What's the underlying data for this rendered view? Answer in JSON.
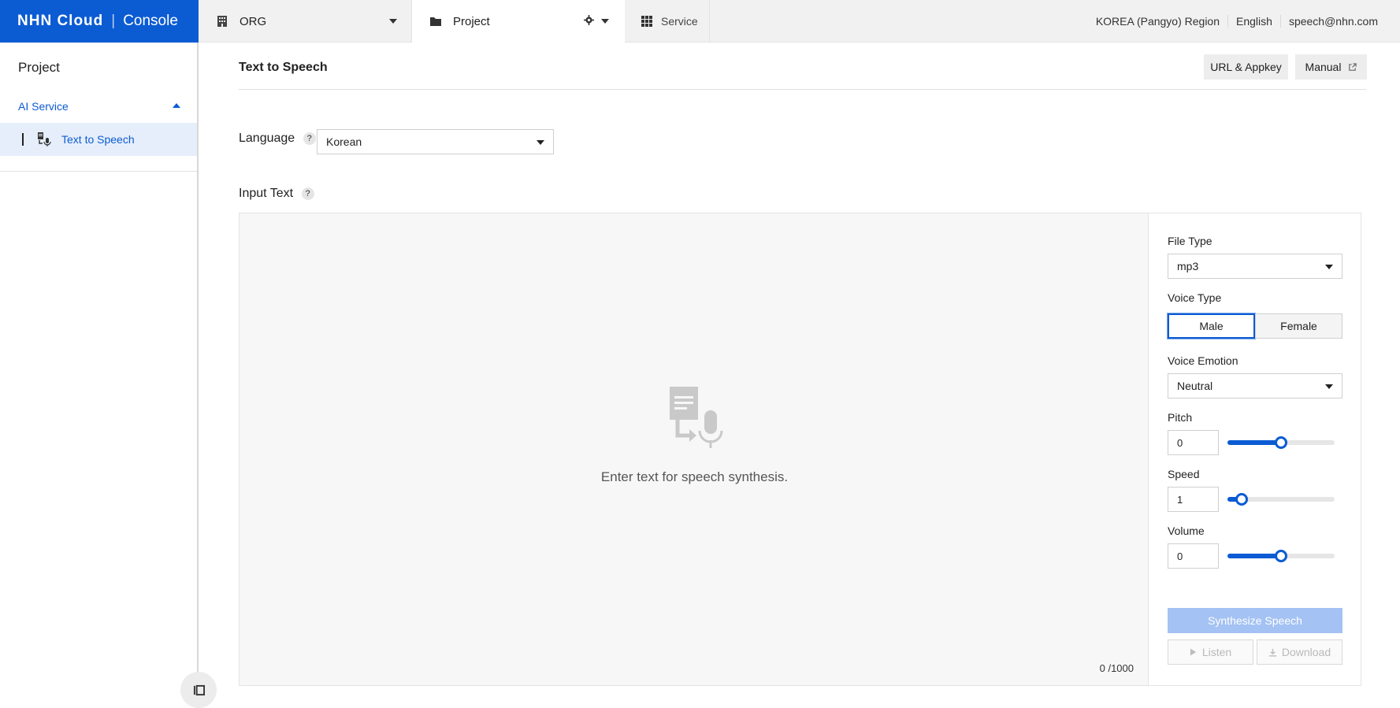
{
  "topbar": {
    "brand": "NHN Cloud",
    "console": "Console",
    "org_label": "ORG",
    "project_label": "Project",
    "service_label": "Service",
    "region": "KOREA (Pangyo) Region",
    "language": "English",
    "user": "speech@nhn.com"
  },
  "sidebar": {
    "title": "Project",
    "section": "AI Service",
    "items": [
      {
        "label": "Text to Speech"
      }
    ]
  },
  "main": {
    "title": "Text to Speech",
    "url_appkey": "URL & Appkey",
    "manual": "Manual",
    "language_label": "Language",
    "language_value": "Korean",
    "input_label": "Input Text",
    "input_placeholder": "Enter text for speech synthesis.",
    "counter": "0 /1000"
  },
  "panel": {
    "file_type_label": "File Type",
    "file_type_value": "mp3",
    "voice_type_label": "Voice Type",
    "male": "Male",
    "female": "Female",
    "selected_voice": "Male",
    "emotion_label": "Voice Emotion",
    "emotion_value": "Neutral",
    "pitch_label": "Pitch",
    "pitch_value": "0",
    "pitch_level": 0.5,
    "speed_label": "Speed",
    "speed_value": "1",
    "speed_level": 0.13,
    "volume_label": "Volume",
    "volume_value": "0",
    "volume_level": 0.5,
    "synthesize": "Synthesize Speech",
    "listen": "Listen",
    "download": "Download"
  },
  "colors": {
    "accent": "#0b5bd3",
    "accent_light": "#e6eefb",
    "disabled_button": "#a4c2f3"
  },
  "icons": [
    "building-icon",
    "folder-icon",
    "gear-icon",
    "grid-icon",
    "tts-icon",
    "external-link-icon",
    "help-icon",
    "play-icon",
    "download-icon",
    "sidebar-toggle-icon"
  ]
}
